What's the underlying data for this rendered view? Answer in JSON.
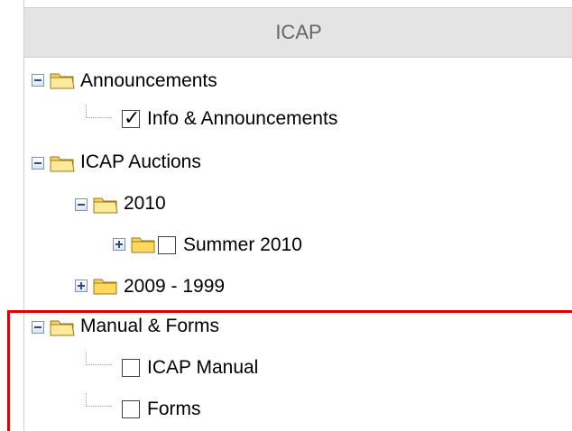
{
  "header": {
    "title": "ICAP"
  },
  "tree": {
    "announcements": "Announcements",
    "info_announcements": "Info & Announcements",
    "auctions": "ICAP Auctions",
    "year_2010": "2010",
    "summer_2010": "Summer 2010",
    "years_archive": "2009 - 1999",
    "manual_forms": "Manual & Forms",
    "icap_manual": "ICAP Manual",
    "forms": "Forms"
  },
  "colors": {
    "header_bg": "#e4e4e4",
    "folder": "#f3c542",
    "highlight": "#e10000"
  }
}
